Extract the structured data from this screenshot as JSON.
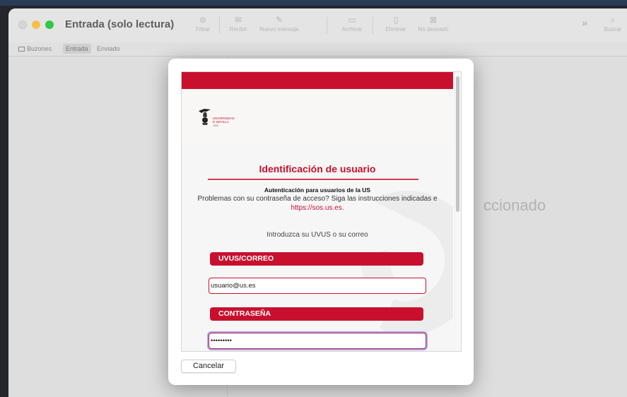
{
  "window": {
    "title": "Entrada (solo lectura)"
  },
  "toolbar": {
    "items": [
      {
        "label": "Filtrar",
        "icon": "filter-icon"
      },
      {
        "label": "Recibir",
        "icon": "envelope-icon"
      },
      {
        "label": "Nuevo mensaje",
        "icon": "compose-icon"
      },
      {
        "label": "Archivar",
        "icon": "archive-icon"
      },
      {
        "label": "Eliminar",
        "icon": "trash-icon"
      },
      {
        "label": "No deseado",
        "icon": "junk-icon"
      }
    ],
    "search_label": "Buscar"
  },
  "tabs": [
    {
      "label": "Buzones",
      "icon": "sidebar-icon"
    },
    {
      "label": "Entrada",
      "active": true
    },
    {
      "label": "Enviado"
    }
  ],
  "no_selection_text": "ccionado",
  "login": {
    "logo_lines": [
      "UNIVERSIDAD",
      "D SEVILLA"
    ],
    "logo_year": "1505",
    "title": "Identificación de usuario",
    "subtitle": "Autenticación para usuarios de la US",
    "problem_text": "Problemas con su contraseña de acceso? Siga las instrucciones indicadas e",
    "link": "https://sos.us.es.",
    "prompt": "Introduzca su UVUS o su correo",
    "user_label": "UVUS/CORREO",
    "user_value": "usuario@us.es",
    "password_label": "CONTRASEÑA",
    "password_value": "password1"
  },
  "cancel_label": "Cancelar",
  "colors": {
    "brand_red": "#c8102e",
    "focus_ring": "#b59ee8"
  }
}
